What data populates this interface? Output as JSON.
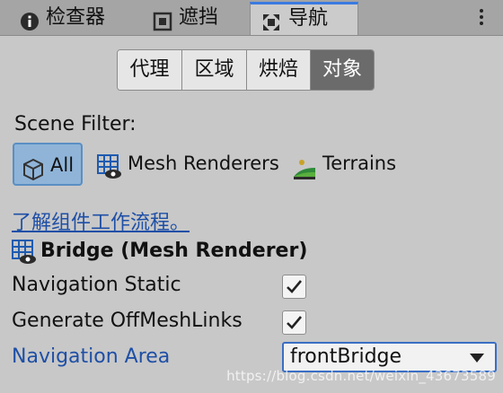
{
  "tabs": [
    {
      "label": "检查器",
      "icon": "info-icon",
      "active": false
    },
    {
      "label": "遮挡",
      "icon": "occlusion-icon",
      "active": false
    },
    {
      "label": "导航",
      "icon": "navigation-icon",
      "active": true
    }
  ],
  "segments": [
    {
      "label": "代理",
      "selected": false
    },
    {
      "label": "区域",
      "selected": false
    },
    {
      "label": "烘焙",
      "selected": false
    },
    {
      "label": "对象",
      "selected": true
    }
  ],
  "scene_filter": {
    "label": "Scene Filter:",
    "options": [
      {
        "label": "All",
        "icon": "cube-icon",
        "selected": true
      },
      {
        "label": "Mesh Renderers",
        "icon": "mesh-renderer-icon",
        "selected": false
      },
      {
        "label": "Terrains",
        "icon": "terrain-icon",
        "selected": false
      }
    ]
  },
  "doc_link": "了解组件工作流程。",
  "object": {
    "title": "Bridge (Mesh Renderer)",
    "icon": "mesh-renderer-icon"
  },
  "properties": {
    "navigation_static": {
      "label": "Navigation Static",
      "checked": true
    },
    "generate_offmeshlinks": {
      "label": "Generate OffMeshLinks",
      "checked": true
    },
    "navigation_area": {
      "label": "Navigation Area",
      "value": "frontBridge"
    }
  },
  "watermark": "https://blog.csdn.net/weixin_43673589",
  "colors": {
    "accent": "#3a7ae0",
    "link": "#1e4fa6",
    "selected_filter_bg": "#8fb4d8",
    "selected_segment_bg": "#6b6b6b"
  }
}
